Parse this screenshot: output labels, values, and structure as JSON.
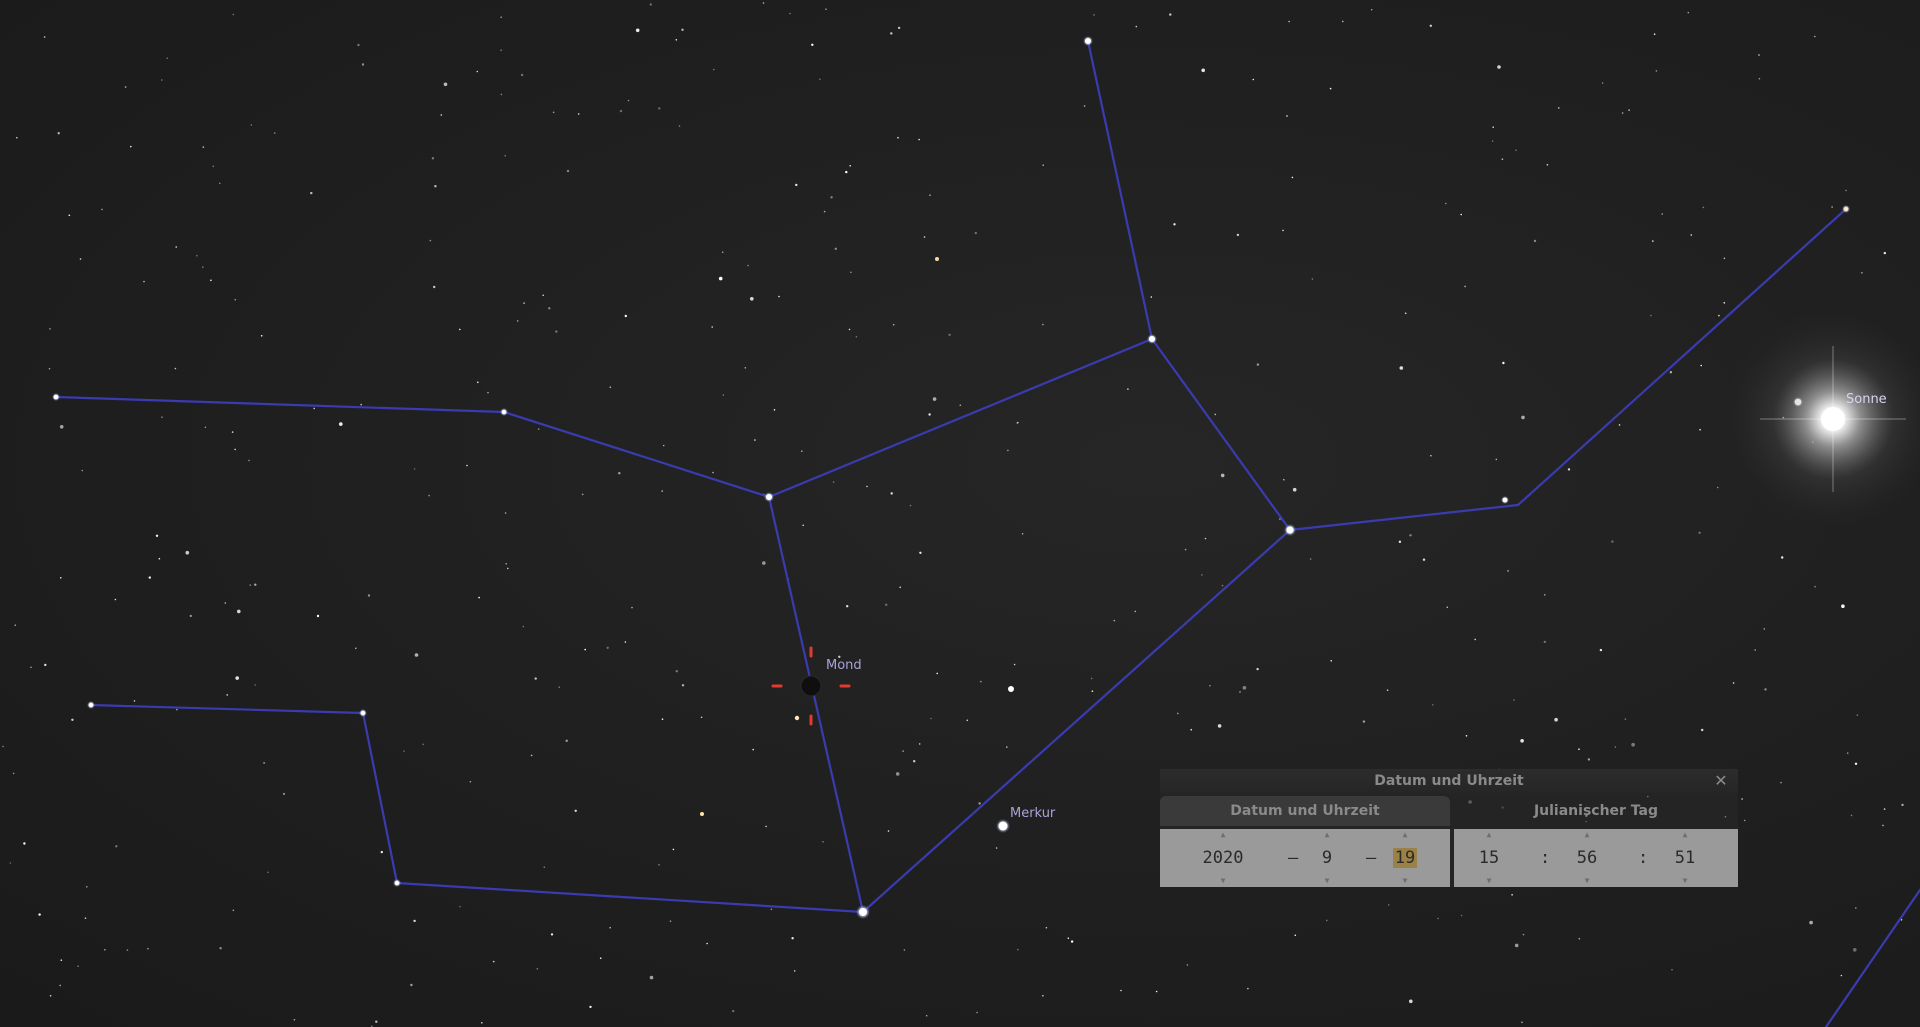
{
  "sky_colors": {
    "background": "#1f1f1f",
    "constellation_line": "#3b3bb0",
    "moon_marker": "#e23a2e",
    "label": "#a9a3d8"
  },
  "objects": {
    "moon_label": "Mond",
    "mercury_label": "Merkur",
    "sun_label": "Sonne"
  },
  "dialog": {
    "title": "Datum und Uhrzeit",
    "close_icon": "close-icon",
    "tabs": [
      {
        "label": "Datum und Uhrzeit",
        "active": true
      },
      {
        "label": "Julianischer Tag",
        "active": false
      }
    ],
    "date": {
      "year": "2020",
      "month": "9",
      "day": "19",
      "separator": "–"
    },
    "time": {
      "hour": "15",
      "minute": "56",
      "second": "51",
      "separator": ":"
    }
  }
}
